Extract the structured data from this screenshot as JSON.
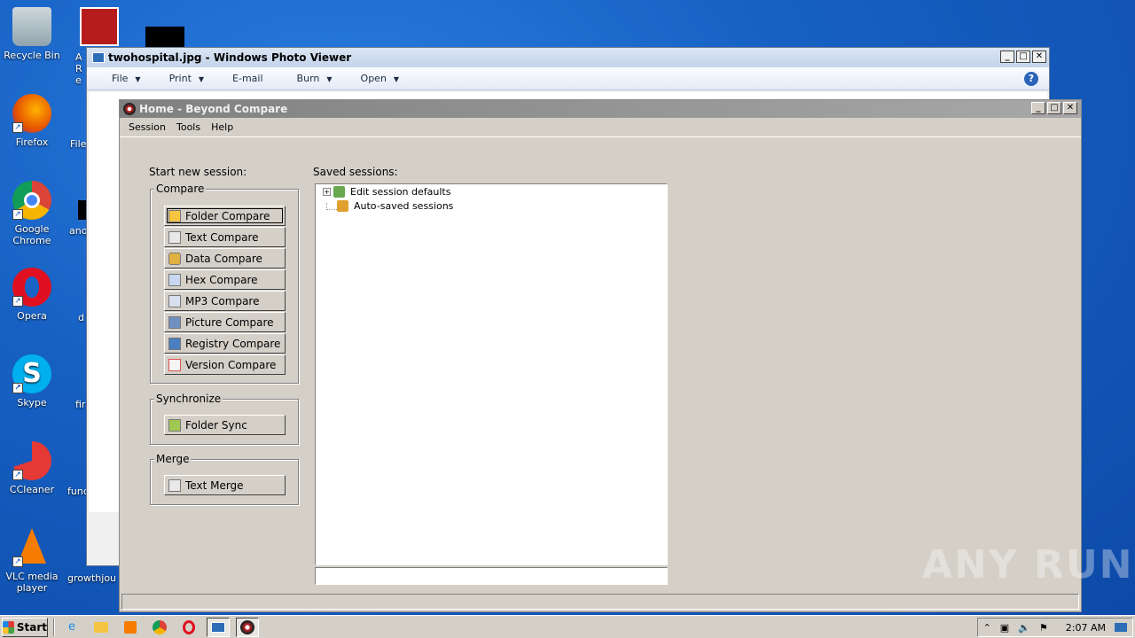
{
  "desktop": {
    "icons": [
      {
        "label": "Recycle Bin"
      },
      {
        "label": "Firefox"
      },
      {
        "label": "Google Chrome"
      },
      {
        "label": "Opera"
      },
      {
        "label": "Skype"
      },
      {
        "label": "CCleaner"
      },
      {
        "label": "VLC media player"
      }
    ],
    "partial_labels": [
      "A Re",
      "File",
      "ano",
      "d",
      "fir",
      "func",
      "growthjou"
    ]
  },
  "photo_viewer": {
    "title": "twohospital.jpg - Windows Photo Viewer",
    "menu": [
      "File",
      "Print",
      "E-mail",
      "Burn",
      "Open"
    ],
    "help": "?"
  },
  "beyond_compare": {
    "title": "Home - Beyond Compare",
    "menu": [
      "Session",
      "Tools",
      "Help"
    ],
    "start_label": "Start new session:",
    "saved_label": "Saved sessions:",
    "compare_group": "Compare",
    "compare_buttons": [
      {
        "label": "Folder Compare",
        "color": "#f5c542"
      },
      {
        "label": "Text Compare",
        "color": "#e8e8e8"
      },
      {
        "label": "Data Compare",
        "color": "#e0b040"
      },
      {
        "label": "Hex Compare",
        "color": "#c8d8f0"
      },
      {
        "label": "MP3 Compare",
        "color": "#d8e0f0"
      },
      {
        "label": "Picture Compare",
        "color": "#7090c0"
      },
      {
        "label": "Registry Compare",
        "color": "#4a80c0"
      },
      {
        "label": "Version Compare",
        "color": "#e05050"
      }
    ],
    "sync_group": "Synchronize",
    "sync_button": "Folder Sync",
    "merge_group": "Merge",
    "merge_button": "Text Merge",
    "tree": [
      {
        "label": "Edit session defaults",
        "expander": "+",
        "color": "#6aa84f"
      },
      {
        "label": "Auto-saved sessions",
        "expander": "",
        "color": "#e0a030"
      }
    ]
  },
  "taskbar": {
    "start": "Start",
    "clock": "2:07 AM"
  },
  "watermark": "ANY RUN"
}
